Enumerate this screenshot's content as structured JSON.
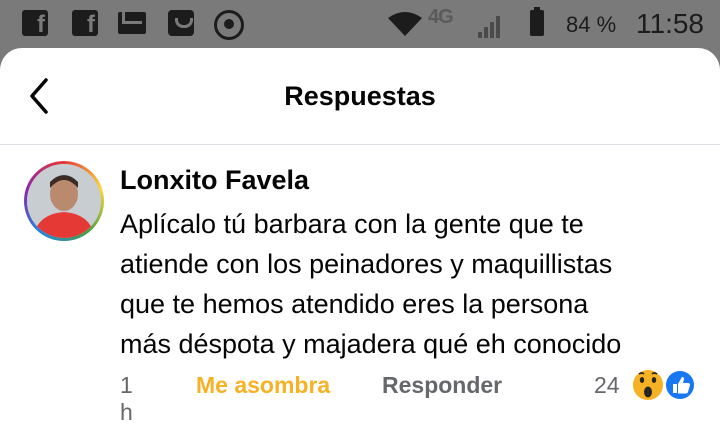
{
  "status_bar": {
    "network": "4G",
    "battery": "84 %",
    "time": "11:58"
  },
  "header": {
    "title": "Respuestas"
  },
  "comment": {
    "author": "Lonxito Favela",
    "lines": [
      "Aplícalo tú barbara con la gente que te",
      "atiende con los peinadores y maquillistas",
      "que te hemos atendido eres la persona",
      "más déspota y majadera qué eh conocido"
    ],
    "time": "1 h",
    "reaction_label": "Me asombra",
    "reply_label": "Responder",
    "reaction_count": "24",
    "reaction_icons": [
      "wow-icon",
      "like-icon"
    ]
  },
  "colors": {
    "reaction_accent": "#f7b125",
    "like_blue": "#1877f2",
    "muted_text": "#65676b"
  }
}
